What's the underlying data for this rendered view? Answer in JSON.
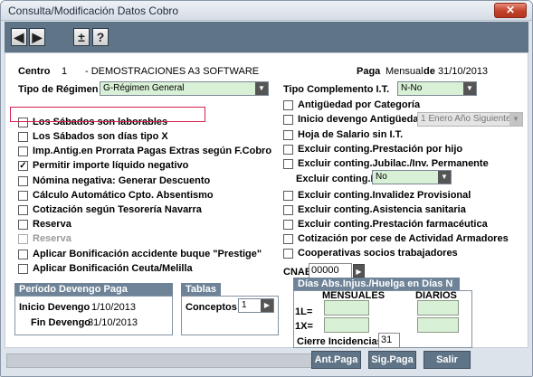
{
  "window": {
    "title": "Consulta/Modificación Datos Cobro",
    "close": "✕"
  },
  "toolbar": {
    "prev": "◀",
    "next": "▶",
    "plusminus": "±",
    "help": "?"
  },
  "header": {
    "centro_label": "Centro",
    "centro_code": "1",
    "centro_name": "-  DEMOSTRACIONES A3 SOFTWARE",
    "paga_label": "Paga",
    "paga_value": "Mensual",
    "de_label": "de",
    "paga_date": "31/10/2013"
  },
  "tipo_regimen": {
    "label": "Tipo de Régimen",
    "value": "G-Régimen General"
  },
  "tipo_complemento": {
    "label": "Tipo Complemento I.T.",
    "value": "N-No"
  },
  "left_checks": [
    {
      "label": "Los Sábados son laborables",
      "checked": false,
      "enabled": true
    },
    {
      "label": "Los Sábados son días tipo X",
      "checked": false,
      "enabled": true
    },
    {
      "label": "Imp.Antig.en Prorrata Pagas Extras según F.Cobro",
      "checked": false,
      "enabled": true
    },
    {
      "label": "Permitir importe líquido negativo",
      "checked": true,
      "enabled": true
    },
    {
      "label": "Nómina negativa: Generar Descuento",
      "checked": false,
      "enabled": true
    },
    {
      "label": "Cálculo Automático Cpto. Absentismo",
      "checked": false,
      "enabled": true
    },
    {
      "label": "Cotización según Tesorería Navarra",
      "checked": false,
      "enabled": true
    },
    {
      "label": "Reserva",
      "checked": false,
      "enabled": true
    },
    {
      "label": "Reserva",
      "checked": false,
      "enabled": false
    },
    {
      "label": "Aplicar Bonificación accidente buque \"Prestige\"",
      "checked": false,
      "enabled": true
    },
    {
      "label": "Aplicar Bonificación Ceuta/Melilla",
      "checked": false,
      "enabled": true
    }
  ],
  "right_checks": {
    "antiguedad_categoria": "Antigüedad por Categoría",
    "inicio_antiguedad": "Inicio devengo Antigüedad:",
    "inicio_antiguedad_value": "1 Enero Año Siguiente",
    "hoja_salario": "Hoja de Salario sin I.T.",
    "excluir_hijo": "Excluir conting.Prestación por hijo",
    "excluir_jubilac": "Excluir conting.Jubilac./Inv. Permanente",
    "excluir_it_label": "Excluir conting.IT",
    "excluir_it_value": "No",
    "excluir_invalidez": "Excluir conting.Invalidez Provisional",
    "excluir_asistencia": "Excluir conting.Asistencia sanitaria",
    "excluir_farmaceutica": "Excluir conting.Prestación farmacéutica",
    "cotizacion_cese": "Cotización por cese de Actividad Armadores",
    "cooperativas": "Cooperativas socios trabajadores"
  },
  "cnae": {
    "label": "CNAE",
    "value": "00000"
  },
  "periodo": {
    "title": "Período Devengo Paga",
    "inicio_label": "Inicio Devengo",
    "inicio_value": "1/10/2013",
    "fin_label": "Fin Devengo",
    "fin_value": "31/10/2013"
  },
  "tablas": {
    "title": "Tablas",
    "conceptos_label": "Conceptos",
    "conceptos_value": "1"
  },
  "dias_abs": {
    "title": "Días Abs.Injus./Huelga en Días N",
    "mensuales": "MENSUALES",
    "diarios": "DIARIOS",
    "row1": "1L=",
    "row2": "1X=",
    "cierre_label": "Cierre Incidencias",
    "cierre_value": "31"
  },
  "buttons": {
    "ant": "Ant.Paga",
    "sig": "Sig.Paga",
    "salir": "Salir"
  },
  "icons": {
    "dropdown": "▼",
    "arrow_right": "▶",
    "check": "✓"
  }
}
